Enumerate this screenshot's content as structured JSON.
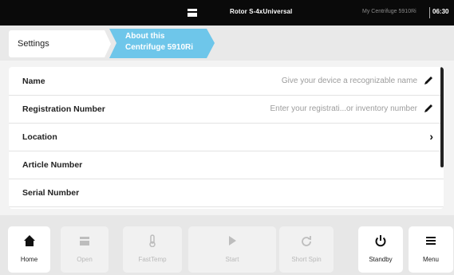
{
  "statusbar": {
    "rotor": "Rotor S-4xUniversal",
    "device": "My Centrifuge 5910Ri",
    "time": "06:30",
    "rotor_icon": "rotor-icon"
  },
  "breadcrumb": {
    "settings": "Settings",
    "about_line1": "About this",
    "about_line2": "Centrifuge 5910Ri",
    "accent_color": "#6ec6ea"
  },
  "list": {
    "rows": [
      {
        "label": "Name",
        "hint": "Give your device a recognizable name",
        "action": "edit-icon"
      },
      {
        "label": "Registration Number",
        "hint": "Enter your registrati...or inventory number",
        "action": "edit-icon"
      },
      {
        "label": "Location",
        "hint": "",
        "action": "chevron-right-icon"
      },
      {
        "label": "Article Number",
        "hint": "",
        "action": ""
      },
      {
        "label": "Serial Number",
        "hint": "",
        "action": ""
      }
    ]
  },
  "bottombar": {
    "home": "Home",
    "open": "Open",
    "fasttemp": "FastTemp",
    "start": "Start",
    "short_spin": "Short Spin",
    "standby": "Standby",
    "menu": "Menu"
  }
}
